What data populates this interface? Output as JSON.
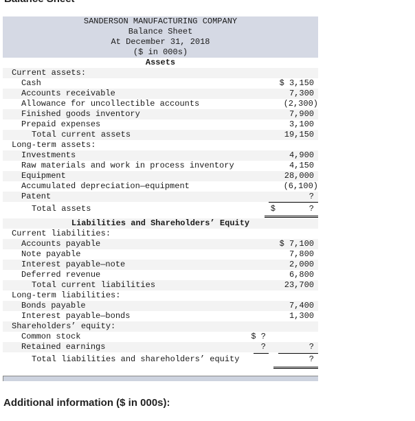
{
  "page_heading_cutoff": "Balance Sheet",
  "statement": {
    "company": "SANDERSON MANUFACTURING COMPANY",
    "title": "Balance Sheet",
    "date": "At December 31, 2018",
    "units": "($ in 000s)"
  },
  "assets": {
    "heading": "Assets",
    "current_heading": "Current assets:",
    "current": [
      {
        "label": "Cash",
        "amount": "$ 3,150"
      },
      {
        "label": "Accounts receivable",
        "amount": "7,300"
      },
      {
        "label": "Allowance for uncollectible accounts",
        "amount": "(2,300)"
      },
      {
        "label": "Finished goods inventory",
        "amount": "7,900"
      },
      {
        "label": "Prepaid expenses",
        "amount": "3,100"
      }
    ],
    "total_current": {
      "label": "Total current assets",
      "amount": "19,150"
    },
    "longterm_heading": "Long-term assets:",
    "longterm": [
      {
        "label": "Investments",
        "amount": "4,900"
      },
      {
        "label": "Raw materials and work in process inventory",
        "amount": "4,150"
      },
      {
        "label": "Equipment",
        "amount": "28,000"
      },
      {
        "label": "Accumulated depreciation—equipment",
        "amount": "(6,100)"
      },
      {
        "label": "Patent",
        "amount": "?"
      }
    ],
    "total": {
      "label": "Total assets",
      "currency": "$",
      "amount": "?"
    }
  },
  "liabilities_equity": {
    "heading": "Liabilities and Shareholders’ Equity",
    "current_heading": "Current liabilities:",
    "current": [
      {
        "label": "Accounts payable",
        "amount": "$ 7,100"
      },
      {
        "label": "Note payable",
        "amount": "7,800"
      },
      {
        "label": "Interest payable—note",
        "amount": "2,000"
      },
      {
        "label": "Deferred revenue",
        "amount": "6,800"
      }
    ],
    "total_current": {
      "label": "Total current liabilities",
      "amount": "23,700"
    },
    "longterm_heading": "Long-term liabilities:",
    "longterm": [
      {
        "label": "Bonds payable",
        "amount": "7,400"
      },
      {
        "label": "Interest payable—bonds",
        "amount": "1,300"
      }
    ],
    "equity_heading": "Shareholders’ equity:",
    "equity": [
      {
        "label": "Common stock",
        "amount": "$ ?"
      },
      {
        "label": "Retained earnings",
        "amount": "?",
        "total": "?"
      }
    ],
    "total": {
      "label": "Total liabilities and shareholders’ equity",
      "amount": "?"
    }
  },
  "additional_info_heading": "Additional information ($ in 000s):"
}
